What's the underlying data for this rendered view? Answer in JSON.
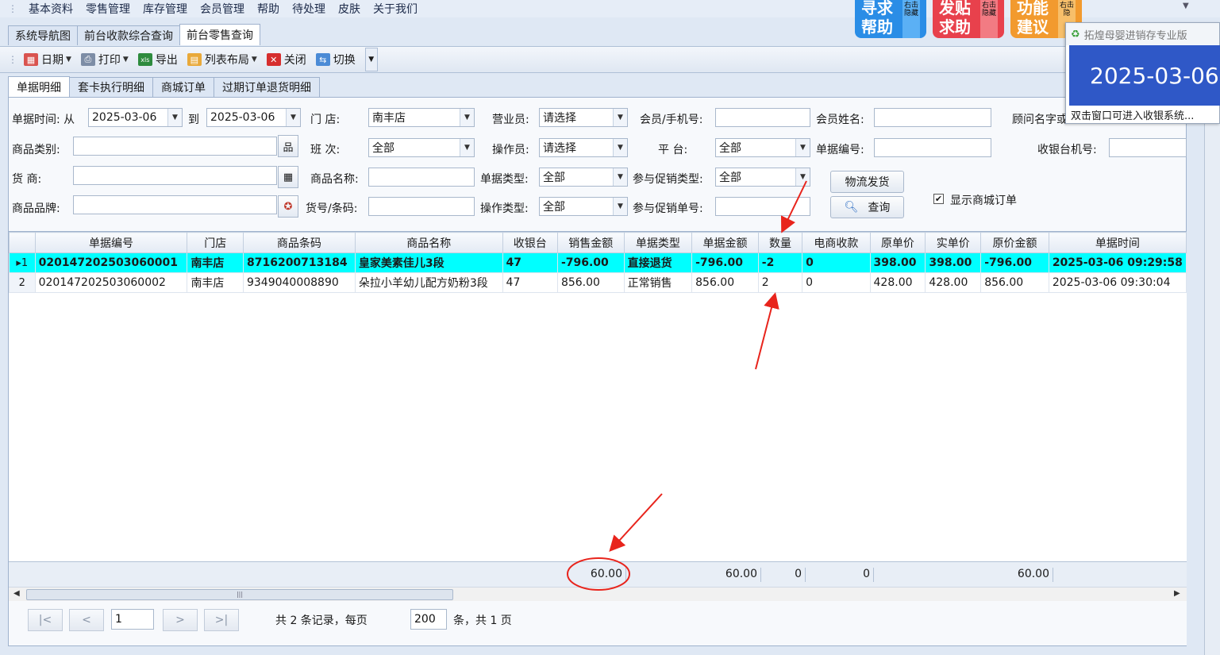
{
  "menu": [
    "基本资料",
    "零售管理",
    "库存管理",
    "会员管理",
    "帮助",
    "待处理",
    "皮肤",
    "关于我们"
  ],
  "badges": {
    "help": {
      "line1": "寻求",
      "line2": "帮助",
      "side": "右击隐藏"
    },
    "post": {
      "line1": "发贴",
      "line2": "求助",
      "side": "右击隐藏"
    },
    "suggest": {
      "line1": "功能",
      "line2": "建议",
      "side": "右击隐"
    }
  },
  "doc_tabs": [
    "系统导航图",
    "前台收款综合查询",
    "前台零售查询"
  ],
  "toolbar": [
    "日期",
    "打印",
    "导出",
    "列表布局",
    "关闭",
    "切换"
  ],
  "sub_tabs": [
    "单据明细",
    "套卡执行明细",
    "商城订单",
    "过期订单退货明细"
  ],
  "filters": {
    "time_label": "单据时间: 从",
    "date_from": "2025-03-06",
    "to_label": "到",
    "date_to": "2025-03-06",
    "store_label": "门      店:",
    "store_value": "南丰店",
    "salesperson_label": "营业员:",
    "salesperson_value": "请选择",
    "member_phone_label": "会员/手机号:",
    "member_name_label": "会员姓名:",
    "advisor_label": "顾问名字或",
    "category_label": "商品类别:",
    "shift_label": "班      次:",
    "shift_value": "全部",
    "operator_label": "操作员:",
    "operator_value": "请选择",
    "platform_label": "平      台:",
    "platform_value": "全部",
    "docno_label": "单据编号:",
    "cashier_no_label": "收银台机号:",
    "supplier_label": "货      商:",
    "product_name_label": "商品名称:",
    "doctype_label": "单据类型:",
    "doctype_value": "全部",
    "promo_type_label": "参与促销类型:",
    "promo_type_value": "全部",
    "logistics_button": "物流发货",
    "brand_label": "商品品牌:",
    "barcode_label": "货号/条码:",
    "optype_label": "操作类型:",
    "optype_value": "全部",
    "promo_no_label": "参与促销单号:",
    "query_button": "查询",
    "show_mall_orders": "显示商城订单"
  },
  "grid": {
    "columns": [
      "单据编号",
      "门店",
      "商品条码",
      "商品名称",
      "收银台",
      "销售金额",
      "单据类型",
      "单据金额",
      "数量",
      "电商收款",
      "原单价",
      "实单价",
      "原价金额",
      "单据时间"
    ],
    "rows": [
      {
        "idx": "1",
        "cells": [
          "020147202503060001",
          "南丰店",
          "8716200713184",
          "皇家美素佳儿3段",
          "47",
          "-796.00",
          "直接退货",
          "-796.00",
          "-2",
          "0",
          "398.00",
          "398.00",
          "-796.00",
          "2025-03-06 09:29:58"
        ]
      },
      {
        "idx": "2",
        "cells": [
          "020147202503060002",
          "南丰店",
          "9349040008890",
          "朵拉小羊幼儿配方奶粉3段",
          "47",
          "856.00",
          "正常销售",
          "856.00",
          "2",
          "0",
          "428.00",
          "428.00",
          "856.00",
          "2025-03-06 09:30:04"
        ]
      }
    ],
    "totals": {
      "sales_amount": "60.00",
      "doc_amount": "60.00",
      "quantity": "0",
      "ecom": "0",
      "orig_amount": "60.00"
    }
  },
  "pager": {
    "first": "|<",
    "prev": "<",
    "page_input": "1",
    "next": ">",
    "last": ">|",
    "summary_prefix": "共 2 条记录，每页",
    "page_size": "200",
    "summary_suffix": "条，共 1 页"
  },
  "popup": {
    "title": "拓煌母婴进销存专业版",
    "date": "2025-03-06",
    "footer": "双击窗口可进入收银系统..."
  },
  "colors": {
    "selected_row": "#00ffff",
    "annotation": "#e8241c",
    "popup_blue": "#2f58c7"
  }
}
